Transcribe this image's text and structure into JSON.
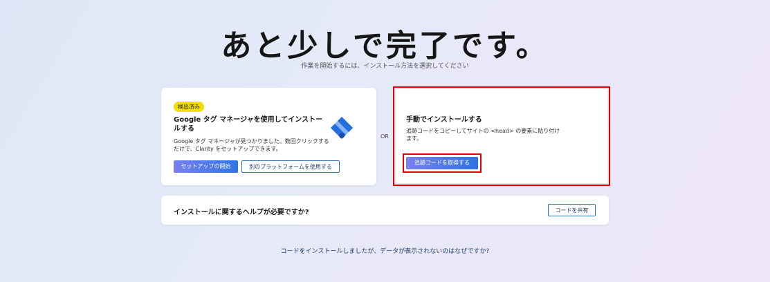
{
  "header": {
    "title": "あと少しで完了です。",
    "subtitle": "作業を開始するには、インストール方法を選択してください"
  },
  "gtm_card": {
    "badge": "検出済み",
    "title": "Google タグ マネージャを使用してインストールする",
    "description": "Google タグ マネージャが見つかりました。数回クリックするだけで、Clarity をセットアップできます。",
    "start_label": "セットアップの開始",
    "other_platform_label": "別のプラットフォームを使用する",
    "logo_icon": "google-tag-manager-icon",
    "logo_colors": {
      "dark": "#246fdb",
      "light": "#8ab4f8"
    }
  },
  "or_label": "OR",
  "manual_card": {
    "title": "手動でインストールする",
    "description": "追跡コードをコピーしてサイトの <head> の要素に貼り付けます。",
    "get_code_label": "追跡コードを取得する",
    "highlight_color": "#e00000"
  },
  "help_card": {
    "title": "インストールに関するヘルプが必要ですか?",
    "share_label": "コードを共有"
  },
  "footer": {
    "link": "コードをインストールしましたが、データが表示されないのはなぜですか?"
  }
}
